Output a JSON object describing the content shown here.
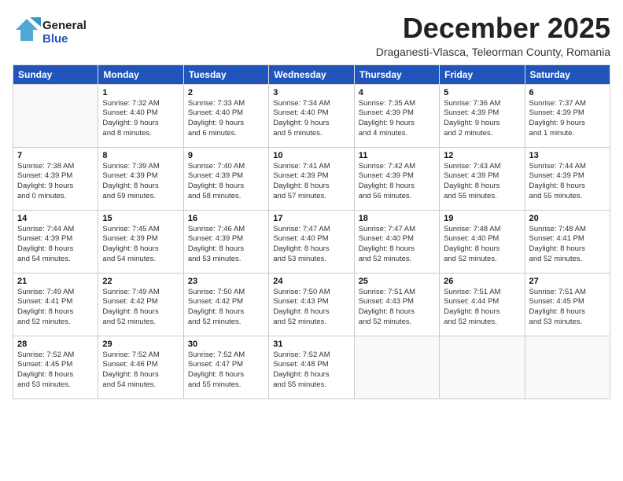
{
  "header": {
    "logo_line1": "General",
    "logo_line2": "Blue",
    "month_title": "December 2025",
    "subtitle": "Draganesti-Vlasca, Teleorman County, Romania"
  },
  "days_of_week": [
    "Sunday",
    "Monday",
    "Tuesday",
    "Wednesday",
    "Thursday",
    "Friday",
    "Saturday"
  ],
  "weeks": [
    [
      {
        "day": "",
        "info": ""
      },
      {
        "day": "1",
        "info": "Sunrise: 7:32 AM\nSunset: 4:40 PM\nDaylight: 9 hours\nand 8 minutes."
      },
      {
        "day": "2",
        "info": "Sunrise: 7:33 AM\nSunset: 4:40 PM\nDaylight: 9 hours\nand 6 minutes."
      },
      {
        "day": "3",
        "info": "Sunrise: 7:34 AM\nSunset: 4:40 PM\nDaylight: 9 hours\nand 5 minutes."
      },
      {
        "day": "4",
        "info": "Sunrise: 7:35 AM\nSunset: 4:39 PM\nDaylight: 9 hours\nand 4 minutes."
      },
      {
        "day": "5",
        "info": "Sunrise: 7:36 AM\nSunset: 4:39 PM\nDaylight: 9 hours\nand 2 minutes."
      },
      {
        "day": "6",
        "info": "Sunrise: 7:37 AM\nSunset: 4:39 PM\nDaylight: 9 hours\nand 1 minute."
      }
    ],
    [
      {
        "day": "7",
        "info": "Sunrise: 7:38 AM\nSunset: 4:39 PM\nDaylight: 9 hours\nand 0 minutes."
      },
      {
        "day": "8",
        "info": "Sunrise: 7:39 AM\nSunset: 4:39 PM\nDaylight: 8 hours\nand 59 minutes."
      },
      {
        "day": "9",
        "info": "Sunrise: 7:40 AM\nSunset: 4:39 PM\nDaylight: 8 hours\nand 58 minutes."
      },
      {
        "day": "10",
        "info": "Sunrise: 7:41 AM\nSunset: 4:39 PM\nDaylight: 8 hours\nand 57 minutes."
      },
      {
        "day": "11",
        "info": "Sunrise: 7:42 AM\nSunset: 4:39 PM\nDaylight: 8 hours\nand 56 minutes."
      },
      {
        "day": "12",
        "info": "Sunrise: 7:43 AM\nSunset: 4:39 PM\nDaylight: 8 hours\nand 55 minutes."
      },
      {
        "day": "13",
        "info": "Sunrise: 7:44 AM\nSunset: 4:39 PM\nDaylight: 8 hours\nand 55 minutes."
      }
    ],
    [
      {
        "day": "14",
        "info": "Sunrise: 7:44 AM\nSunset: 4:39 PM\nDaylight: 8 hours\nand 54 minutes."
      },
      {
        "day": "15",
        "info": "Sunrise: 7:45 AM\nSunset: 4:39 PM\nDaylight: 8 hours\nand 54 minutes."
      },
      {
        "day": "16",
        "info": "Sunrise: 7:46 AM\nSunset: 4:39 PM\nDaylight: 8 hours\nand 53 minutes."
      },
      {
        "day": "17",
        "info": "Sunrise: 7:47 AM\nSunset: 4:40 PM\nDaylight: 8 hours\nand 53 minutes."
      },
      {
        "day": "18",
        "info": "Sunrise: 7:47 AM\nSunset: 4:40 PM\nDaylight: 8 hours\nand 52 minutes."
      },
      {
        "day": "19",
        "info": "Sunrise: 7:48 AM\nSunset: 4:40 PM\nDaylight: 8 hours\nand 52 minutes."
      },
      {
        "day": "20",
        "info": "Sunrise: 7:48 AM\nSunset: 4:41 PM\nDaylight: 8 hours\nand 52 minutes."
      }
    ],
    [
      {
        "day": "21",
        "info": "Sunrise: 7:49 AM\nSunset: 4:41 PM\nDaylight: 8 hours\nand 52 minutes."
      },
      {
        "day": "22",
        "info": "Sunrise: 7:49 AM\nSunset: 4:42 PM\nDaylight: 8 hours\nand 52 minutes."
      },
      {
        "day": "23",
        "info": "Sunrise: 7:50 AM\nSunset: 4:42 PM\nDaylight: 8 hours\nand 52 minutes."
      },
      {
        "day": "24",
        "info": "Sunrise: 7:50 AM\nSunset: 4:43 PM\nDaylight: 8 hours\nand 52 minutes."
      },
      {
        "day": "25",
        "info": "Sunrise: 7:51 AM\nSunset: 4:43 PM\nDaylight: 8 hours\nand 52 minutes."
      },
      {
        "day": "26",
        "info": "Sunrise: 7:51 AM\nSunset: 4:44 PM\nDaylight: 8 hours\nand 52 minutes."
      },
      {
        "day": "27",
        "info": "Sunrise: 7:51 AM\nSunset: 4:45 PM\nDaylight: 8 hours\nand 53 minutes."
      }
    ],
    [
      {
        "day": "28",
        "info": "Sunrise: 7:52 AM\nSunset: 4:45 PM\nDaylight: 8 hours\nand 53 minutes."
      },
      {
        "day": "29",
        "info": "Sunrise: 7:52 AM\nSunset: 4:46 PM\nDaylight: 8 hours\nand 54 minutes."
      },
      {
        "day": "30",
        "info": "Sunrise: 7:52 AM\nSunset: 4:47 PM\nDaylight: 8 hours\nand 55 minutes."
      },
      {
        "day": "31",
        "info": "Sunrise: 7:52 AM\nSunset: 4:48 PM\nDaylight: 8 hours\nand 55 minutes."
      },
      {
        "day": "",
        "info": ""
      },
      {
        "day": "",
        "info": ""
      },
      {
        "day": "",
        "info": ""
      }
    ]
  ]
}
